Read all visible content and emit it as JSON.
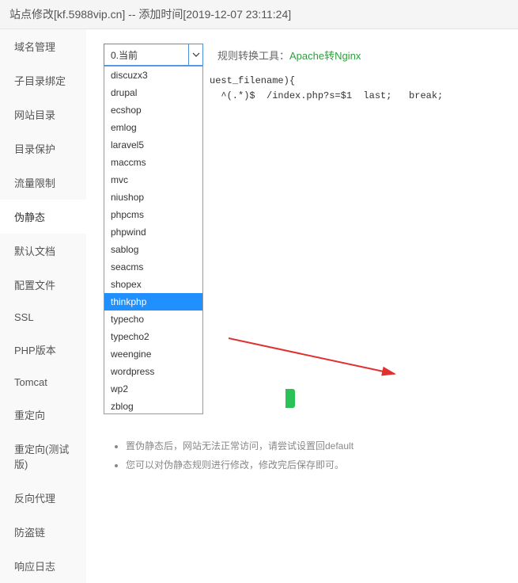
{
  "header": {
    "title": "站点修改[kf.5988vip.cn] -- 添加时间[2019-12-07 23:11:24]"
  },
  "sidebar": {
    "items": [
      {
        "label": "域名管理"
      },
      {
        "label": "子目录绑定"
      },
      {
        "label": "网站目录"
      },
      {
        "label": "目录保护"
      },
      {
        "label": "流量限制"
      },
      {
        "label": "伪静态"
      },
      {
        "label": "默认文档"
      },
      {
        "label": "配置文件"
      },
      {
        "label": "SSL"
      },
      {
        "label": "PHP版本"
      },
      {
        "label": "Tomcat"
      },
      {
        "label": "重定向"
      },
      {
        "label": "重定向(测试版)"
      },
      {
        "label": "反向代理"
      },
      {
        "label": "防盗链"
      },
      {
        "label": "响应日志"
      }
    ],
    "activeIndex": 5
  },
  "select": {
    "current": "0.当前",
    "options": [
      "discuzx3",
      "drupal",
      "ecshop",
      "emlog",
      "laravel5",
      "maccms",
      "mvc",
      "niushop",
      "phpcms",
      "phpwind",
      "sablog",
      "seacms",
      "shopex",
      "thinkphp",
      "typecho",
      "typecho2",
      "weengine",
      "wordpress",
      "wp2",
      "zblog"
    ],
    "selectedOption": "thinkphp"
  },
  "convert": {
    "label": "规则转换工具：",
    "link": "Apache转Nginx"
  },
  "code": {
    "line1": "uest_filename){",
    "line2": "^(.*)$  /index.php?s=$1  last;   break;"
  },
  "notes": {
    "line1_suffix": "置伪静态后，网站无法正常访问，请尝试设置回default",
    "line2": "您可以对伪静态规则进行修改，修改完后保存即可。"
  }
}
